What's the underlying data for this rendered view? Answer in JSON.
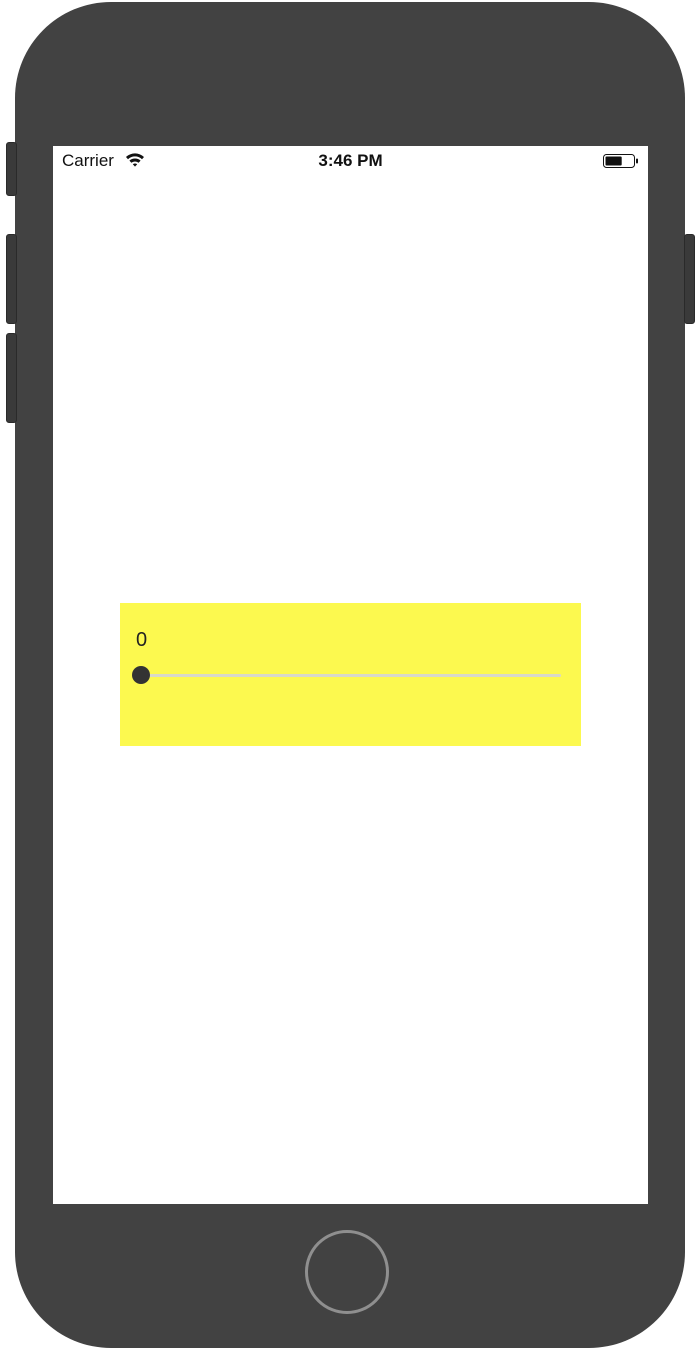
{
  "status_bar": {
    "carrier": "Carrier",
    "time": "3:46 PM",
    "wifi_icon": "wifi-icon",
    "battery_icon": "battery-icon",
    "battery_level": 0.6
  },
  "panel": {
    "background": "#fcf94f",
    "slider": {
      "value_label": "0",
      "value": 0,
      "min": 0,
      "max": 100,
      "thumb_color": "#333333",
      "track_color": "#d8d8c8"
    }
  },
  "device": {
    "frame_color": "#424242",
    "home_button_icon": "home-button"
  }
}
